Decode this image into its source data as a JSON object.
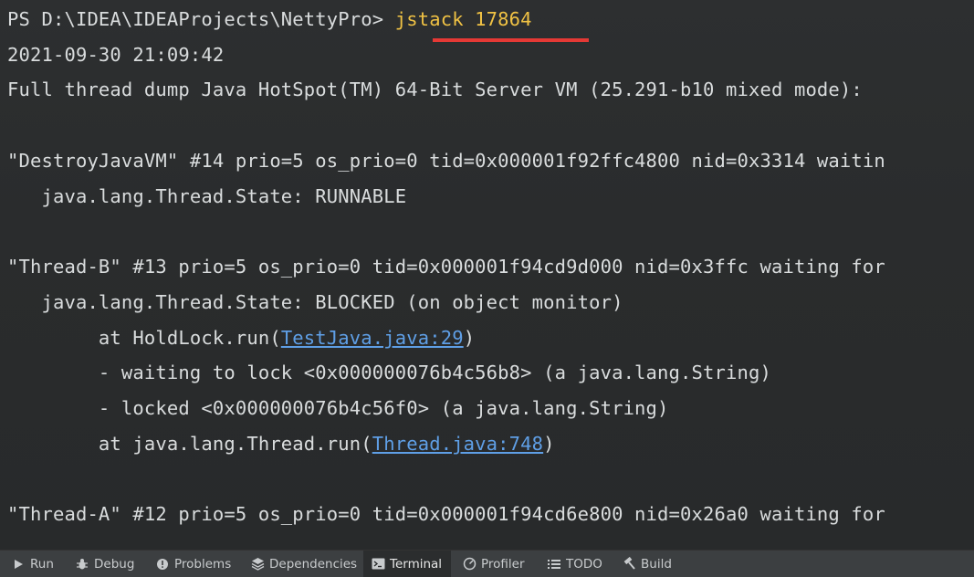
{
  "terminal": {
    "prompt": "PS D:\\IDEA\\IDEAProjects\\NettyPro> ",
    "command": "jstack 17864",
    "lines": [
      "2021-09-30 21:09:42",
      "Full thread dump Java HotSpot(TM) 64-Bit Server VM (25.291-b10 mixed mode):",
      "\"DestroyJavaVM\" #14 prio=5 os_prio=0 tid=0x000001f92ffc4800 nid=0x3314 waitin",
      "   java.lang.Thread.State: RUNNABLE",
      "\"Thread-B\" #13 prio=5 os_prio=0 tid=0x000001f94cd9d000 nid=0x3ffc waiting for",
      "   java.lang.Thread.State: BLOCKED (on object monitor)",
      "        - waiting to lock <0x000000076b4c56b8> (a java.lang.String)",
      "        - locked <0x000000076b4c56f0> (a java.lang.String)",
      "\"Thread-A\" #12 prio=5 os_prio=0 tid=0x000001f94cd6e800 nid=0x26a0 waiting for"
    ],
    "frame1_prefix": "        at HoldLock.run(",
    "frame1_link": "TestJava.java:29",
    "frame1_suffix": ")",
    "frame2_prefix": "        at java.lang.Thread.run(",
    "frame2_link": "Thread.java:748",
    "frame2_suffix": ")"
  },
  "toolbar": {
    "tabs": [
      {
        "label": "Run",
        "icon": "play-icon"
      },
      {
        "label": "Debug",
        "icon": "bug-icon"
      },
      {
        "label": "Problems",
        "icon": "problems-icon"
      },
      {
        "label": "Dependencies",
        "icon": "layers-icon"
      },
      {
        "label": "Terminal",
        "icon": "terminal-icon"
      },
      {
        "label": "Profiler",
        "icon": "profiler-icon"
      },
      {
        "label": "TODO",
        "icon": "list-icon"
      },
      {
        "label": "Build",
        "icon": "hammer-icon"
      }
    ],
    "active": "Terminal"
  },
  "colors": {
    "command": "#f0c244",
    "link": "#5f9fe6",
    "highlight_underline": "#e53935"
  }
}
